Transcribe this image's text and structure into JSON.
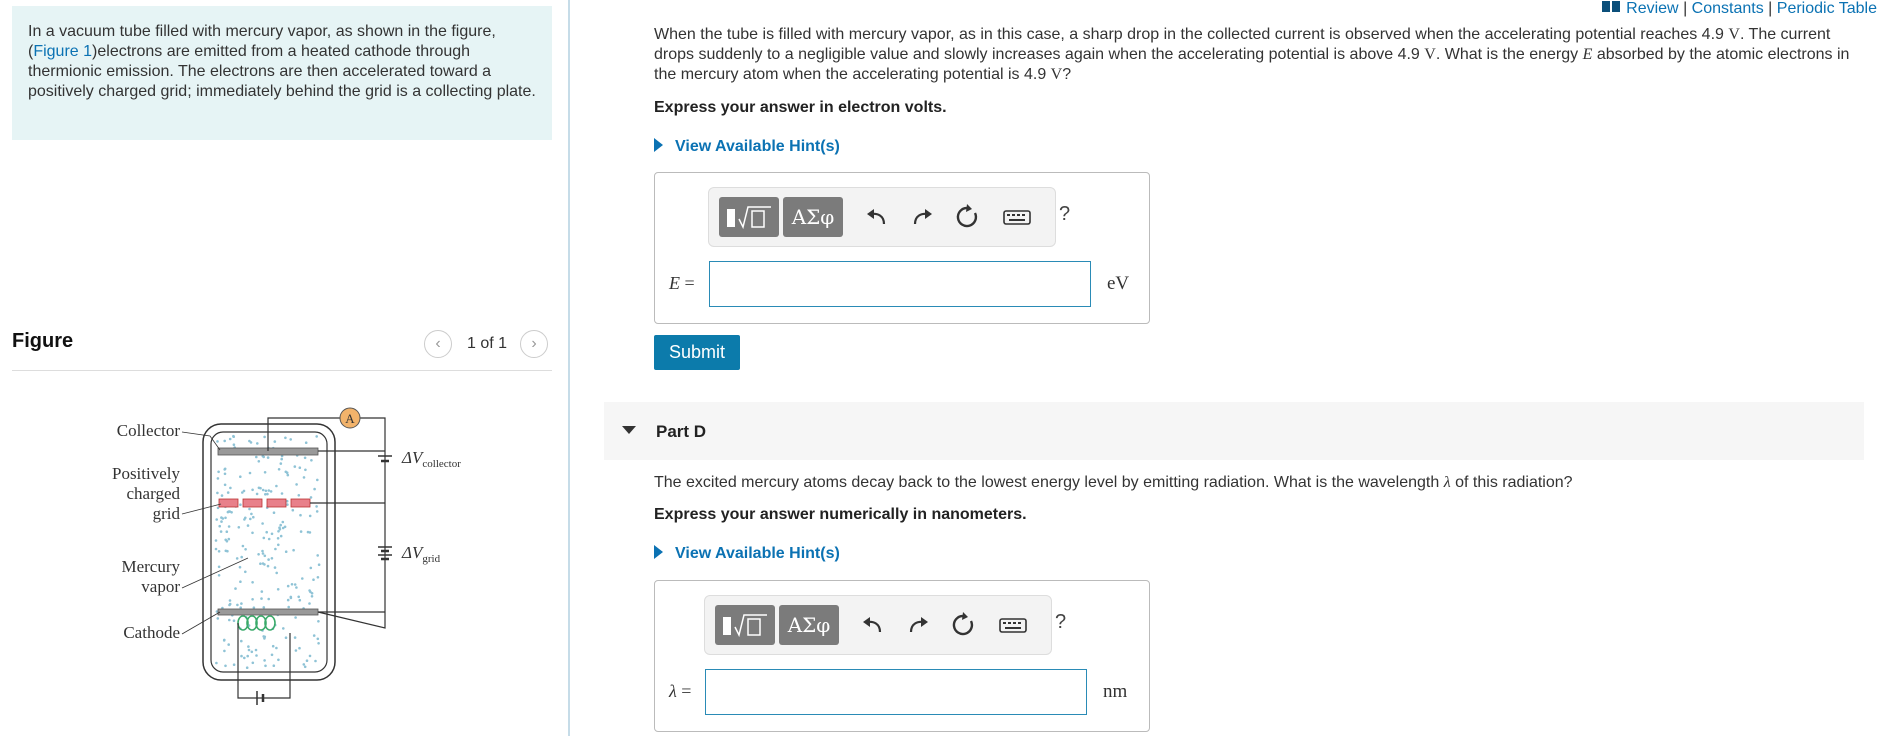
{
  "intro": {
    "text_before": "In a vacuum tube filled with mercury vapor, as shown in the figure, (",
    "figure_link": "Figure 1",
    "text_after": ")electrons are emitted from a heated cathode through thermionic emission. The electrons are then accelerated toward a positively charged grid; immediately behind the grid is a collecting plate."
  },
  "figure": {
    "title": "Figure",
    "pager": "1 of 1",
    "labels": {
      "collector": "Collector",
      "grid_line1": "Positively",
      "grid_line2": "charged",
      "grid_line3": "grid",
      "vapor_line1": "Mercury",
      "vapor_line2": "vapor",
      "cathode": "Cathode",
      "ammeter": "A",
      "v_collector_main": "ΔV",
      "v_collector_sub": "collector",
      "v_grid_main": "ΔV",
      "v_grid_sub": "grid"
    },
    "colors": {
      "grid_bars": "#e8808a",
      "vapor_dots": "#8fc3d6",
      "filament": "#3aaa6a",
      "ammeter": "#f2b36b"
    }
  },
  "top_links": {
    "review": "Review",
    "sep1": "|",
    "constants": "Constants",
    "sep2": "|",
    "periodic_table": "Periodic Table"
  },
  "part_c": {
    "q1": "When the tube is filled with mercury vapor, as in this case, a sharp drop in the collected current is observed when the accelerating potential reaches 4.9",
    "unit_v1": "V",
    "q2": ". The current drops suddenly to a negligible value and slowly increases again when the accelerating potential is above 4.9",
    "unit_v2": "V",
    "q3": ". What is the energy",
    "var_e": "E",
    "q4": "absorbed by the atomic electrons in the mercury atom when the accelerating potential is 4.9",
    "unit_v3": "V",
    "q5": "?",
    "instruction": "Express your answer in electron volts.",
    "hint": "View Available Hint(s)",
    "answer_var": "E",
    "answer_eq": "=",
    "answer_value": "",
    "unit": "eV",
    "submit": "Submit"
  },
  "toolbar": {
    "greek": "ΑΣφ",
    "help": "?"
  },
  "part_d": {
    "title": "Part D",
    "question_before": "The excited mercury atoms decay back to the lowest energy level by emitting radiation. What is the wavelength",
    "var_lambda": "λ",
    "question_after": "of this radiation?",
    "instruction": "Express your answer numerically in nanometers.",
    "hint": "View Available Hint(s)",
    "answer_var": "λ",
    "answer_eq": "=",
    "answer_value": "",
    "unit": "nm"
  }
}
